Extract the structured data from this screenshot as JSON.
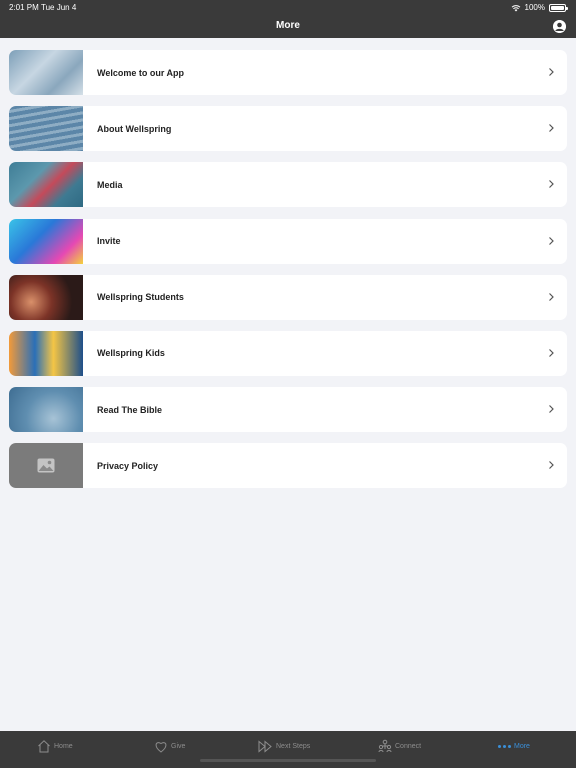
{
  "status_bar": {
    "time": "2:01 PM",
    "date": "Tue Jun 4",
    "battery": "100%"
  },
  "header": {
    "title": "More"
  },
  "menu": [
    {
      "label": "Welcome to our App"
    },
    {
      "label": "About Wellspring"
    },
    {
      "label": "Media"
    },
    {
      "label": "Invite"
    },
    {
      "label": "Wellspring Students"
    },
    {
      "label": "Wellspring Kids"
    },
    {
      "label": "Read The Bible"
    },
    {
      "label": "Privacy Policy"
    }
  ],
  "tabbar": {
    "items": [
      {
        "label": "Home",
        "icon": "home-icon"
      },
      {
        "label": "Give",
        "icon": "heart-icon"
      },
      {
        "label": "Next Steps",
        "icon": "fast-forward-icon"
      },
      {
        "label": "Connect",
        "icon": "people-icon"
      },
      {
        "label": "More",
        "icon": "more-dots-icon",
        "active": true
      }
    ],
    "active_color": "#3a8fd8",
    "inactive_color": "#8d8d8d"
  },
  "colors": {
    "header_bg": "#3a3a3a",
    "page_bg": "#f2f3f7"
  }
}
